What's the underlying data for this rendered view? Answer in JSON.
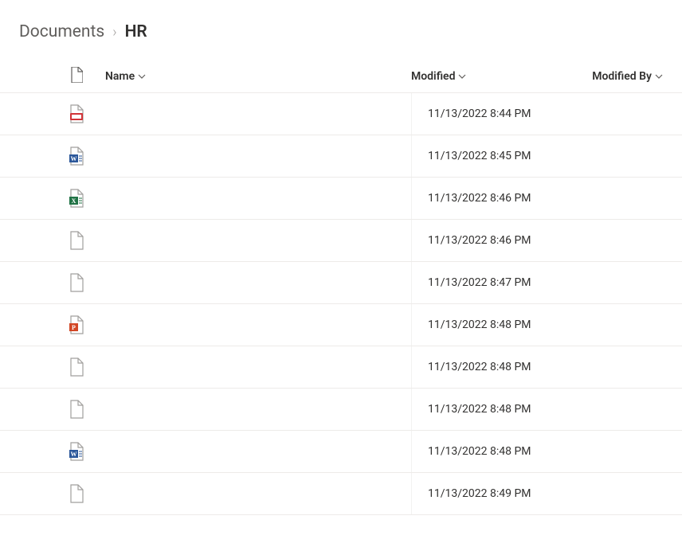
{
  "breadcrumb": {
    "parent": "Documents",
    "separator": "›",
    "current": "HR"
  },
  "columns": {
    "name": "Name",
    "modified": "Modified",
    "modifiedBy": "Modified By"
  },
  "rows": [
    {
      "icon": "pdf",
      "name": "",
      "modified": "11/13/2022 8:44 PM",
      "modifiedBy": ""
    },
    {
      "icon": "word",
      "name": "",
      "modified": "11/13/2022 8:45 PM",
      "modifiedBy": ""
    },
    {
      "icon": "excel",
      "name": "",
      "modified": "11/13/2022 8:46 PM",
      "modifiedBy": ""
    },
    {
      "icon": "generic",
      "name": "",
      "modified": "11/13/2022 8:46 PM",
      "modifiedBy": ""
    },
    {
      "icon": "generic",
      "name": "",
      "modified": "11/13/2022 8:47 PM",
      "modifiedBy": ""
    },
    {
      "icon": "powerpoint",
      "name": "",
      "modified": "11/13/2022 8:48 PM",
      "modifiedBy": ""
    },
    {
      "icon": "generic",
      "name": "",
      "modified": "11/13/2022 8:48 PM",
      "modifiedBy": ""
    },
    {
      "icon": "generic",
      "name": "",
      "modified": "11/13/2022 8:48 PM",
      "modifiedBy": ""
    },
    {
      "icon": "word",
      "name": "",
      "modified": "11/13/2022 8:48 PM",
      "modifiedBy": ""
    },
    {
      "icon": "generic",
      "name": "",
      "modified": "11/13/2022 8:49 PM",
      "modifiedBy": ""
    }
  ]
}
